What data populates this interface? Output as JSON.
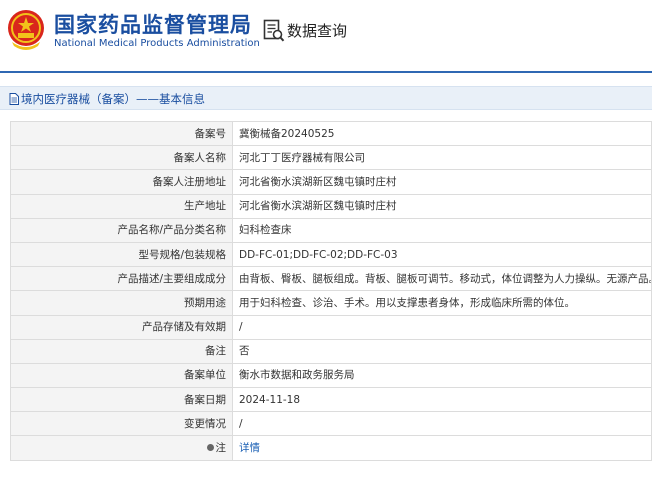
{
  "header": {
    "org_name_cn": "国家药品监督管理局",
    "org_name_en": "National Medical Products Administration",
    "query_title": "数据查询",
    "emblem_icon": "national-emblem-icon",
    "query_icon": "document-search-icon"
  },
  "section": {
    "title": "境内医疗器械（备案）——基本信息",
    "icon": "document-icon"
  },
  "colors": {
    "brand_blue": "#1a4ea0",
    "accent_line": "#2f68b3",
    "section_bg": "#e9f0f8",
    "label_bg": "#f4f4f4",
    "link": "#1a5fb4"
  },
  "rows": [
    {
      "label": "备案号",
      "value": "冀衡械备20240525"
    },
    {
      "label": "备案人名称",
      "value": "河北丁丁医疗器械有限公司"
    },
    {
      "label": "备案人注册地址",
      "value": "河北省衡水滨湖新区魏屯镇时庄村"
    },
    {
      "label": "生产地址",
      "value": "河北省衡水滨湖新区魏屯镇时庄村"
    },
    {
      "label": "产品名称/产品分类名称",
      "value": "妇科检查床"
    },
    {
      "label": "型号规格/包装规格",
      "value": "DD-FC-01;DD-FC-02;DD-FC-03"
    },
    {
      "label": "产品描述/主要组成成分",
      "value": "由背板、臀板、腿板组成。背板、腿板可调节。移动式，体位调整为人力操纵。无源产品。"
    },
    {
      "label": "预期用途",
      "value": "用于妇科检查、诊治、手术。用以支撑患者身体，形成临床所需的体位。"
    },
    {
      "label": "产品存储及有效期",
      "value": "/"
    },
    {
      "label": "备注",
      "value": "否"
    },
    {
      "label": "备案单位",
      "value": "衡水市数据和政务服务局"
    },
    {
      "label": "备案日期",
      "value": "2024-11-18"
    },
    {
      "label": "变更情况",
      "value": "/"
    },
    {
      "label": "注",
      "value": "详情"
    }
  ]
}
